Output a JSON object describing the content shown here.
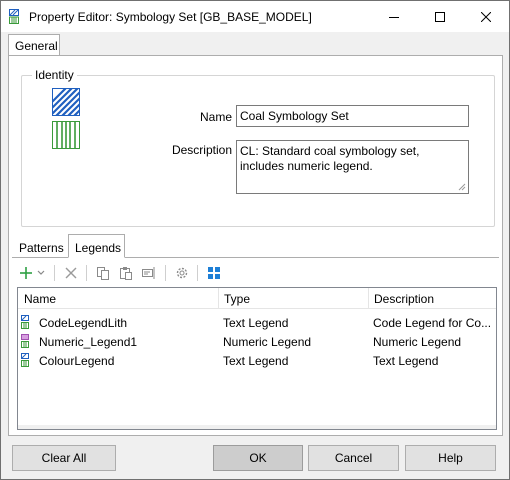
{
  "window": {
    "title": "Property Editor: Symbology Set [GB_BASE_MODEL]"
  },
  "tabs": {
    "general": "General"
  },
  "identity": {
    "legend": "Identity",
    "name_label": "Name",
    "name_value": "Coal Symbology Set",
    "description_label": "Description",
    "description_value": "CL: Standard coal symbology set, includes numeric legend."
  },
  "subtabs": {
    "patterns": "Patterns",
    "legends": "Legends"
  },
  "toolbar": {
    "icons": [
      "add-icon",
      "dropdown-arrow-icon",
      "delete-icon",
      "copy-icon",
      "paste-icon",
      "rename-icon",
      "settings-icon",
      "grid-view-icon"
    ]
  },
  "legends_table": {
    "columns": [
      "Name",
      "Type",
      "Description"
    ],
    "rows": [
      {
        "name": "CodeLegendLith",
        "type": "Text Legend",
        "description": "Code Legend for Co...",
        "icon": "text-legend-icon"
      },
      {
        "name": "Numeric_Legend1",
        "type": "Numeric Legend",
        "description": "Numeric Legend",
        "icon": "numeric-legend-icon"
      },
      {
        "name": "ColourLegend",
        "type": "Text Legend",
        "description": "Text Legend",
        "icon": "text-legend-icon"
      }
    ]
  },
  "buttons": {
    "clear_all": "Clear All",
    "ok": "OK",
    "cancel": "Cancel",
    "help": "Help"
  },
  "colors": {
    "accent_blue": "#1f5fbf",
    "pattern_green": "#3a9a3a",
    "numeric_purple": "#a050b0",
    "add_green": "#2ea043"
  }
}
